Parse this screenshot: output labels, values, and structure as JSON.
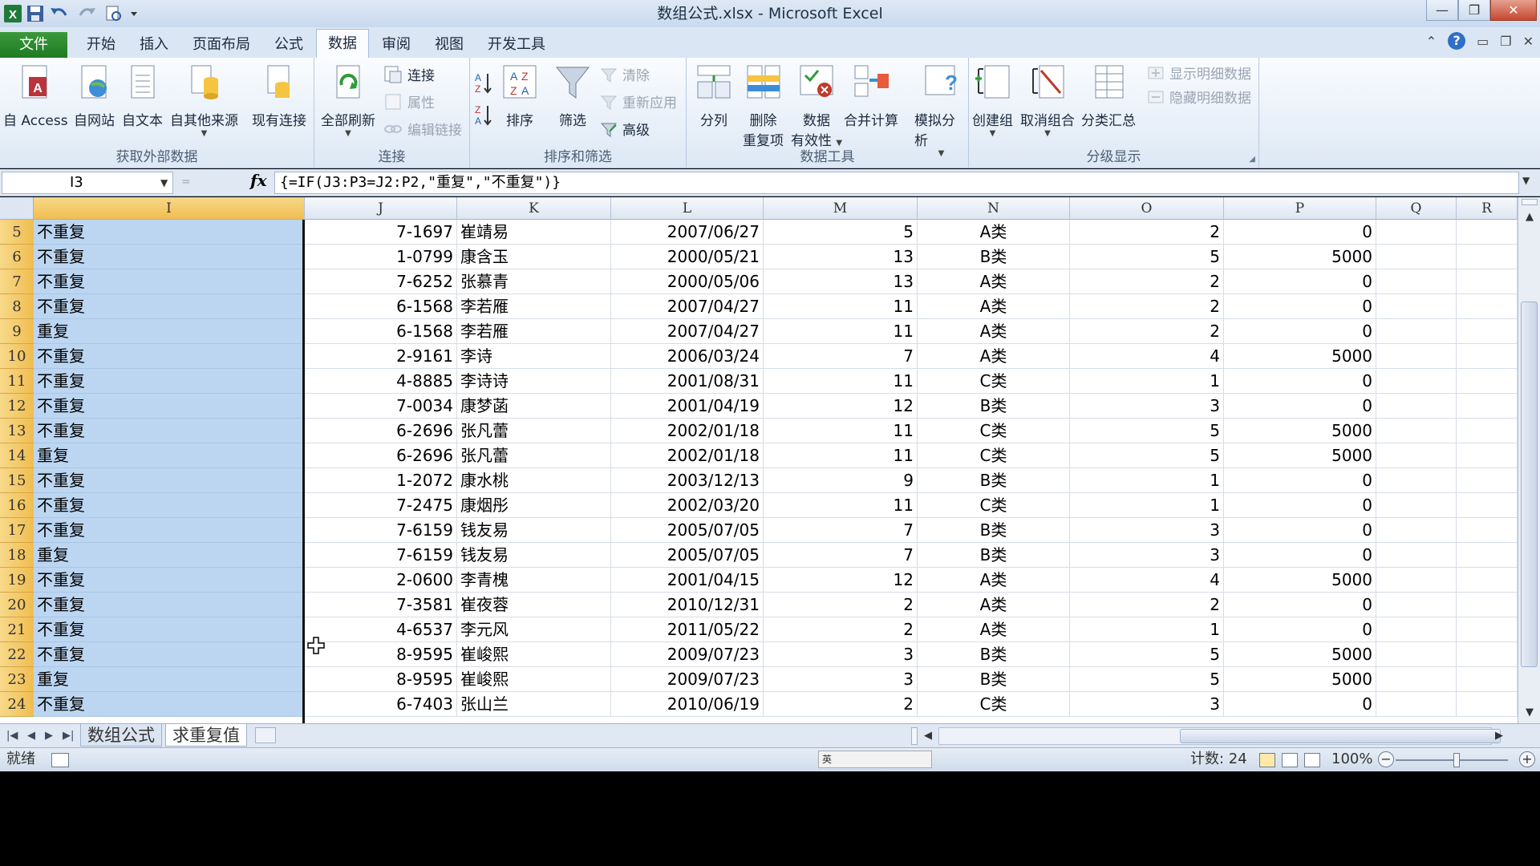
{
  "window": {
    "title": "数组公式.xlsx - Microsoft Excel"
  },
  "tabs": [
    {
      "label": "文件"
    },
    {
      "label": "开始"
    },
    {
      "label": "插入"
    },
    {
      "label": "页面布局"
    },
    {
      "label": "公式"
    },
    {
      "label": "数据"
    },
    {
      "label": "审阅"
    },
    {
      "label": "视图"
    },
    {
      "label": "开发工具"
    }
  ],
  "ribbon": {
    "ext": {
      "label": "获取外部数据",
      "access": "自 Access",
      "web": "自网站",
      "text": "自文本",
      "other": "自其他来源",
      "existing": "现有连接"
    },
    "conn": {
      "label": "连接",
      "refresh": "全部刷新",
      "connections": "连接",
      "properties": "属性",
      "edit_links": "编辑链接"
    },
    "sort": {
      "label": "排序和筛选",
      "sort": "排序",
      "filter": "筛选",
      "clear": "清除",
      "reapply": "重新应用",
      "advanced": "高级"
    },
    "tools": {
      "label": "数据工具",
      "split": "分列",
      "remove_dup_1": "删除",
      "remove_dup_2": "重复项",
      "validation_1": "数据",
      "validation_2": "有效性",
      "consolidate": "合并计算",
      "whatif": "模拟分析"
    },
    "outline": {
      "label": "分级显示",
      "group": "创建组",
      "ungroup": "取消组合",
      "subtotal": "分类汇总",
      "show_detail": "显示明细数据",
      "hide_detail": "隐藏明细数据"
    }
  },
  "formula_bar": {
    "name_box": "I3",
    "formula": "{=IF(J3:P3=J2:P2,\"重复\",\"不重复\")}"
  },
  "columns": [
    "I",
    "J",
    "K",
    "L",
    "M",
    "N",
    "O",
    "P",
    "Q",
    "R"
  ],
  "rows": [
    {
      "num": "5",
      "I": "不重复",
      "J": "7-1697",
      "K": "崔靖易",
      "L": "2007/06/27",
      "M": "5",
      "N": "A类",
      "O": "2",
      "P": "0"
    },
    {
      "num": "6",
      "I": "不重复",
      "J": "1-0799",
      "K": "康含玉",
      "L": "2000/05/21",
      "M": "13",
      "N": "B类",
      "O": "5",
      "P": "5000"
    },
    {
      "num": "7",
      "I": "不重复",
      "J": "7-6252",
      "K": "张慕青",
      "L": "2000/05/06",
      "M": "13",
      "N": "A类",
      "O": "2",
      "P": "0"
    },
    {
      "num": "8",
      "I": "不重复",
      "J": "6-1568",
      "K": "李若雁",
      "L": "2007/04/27",
      "M": "11",
      "N": "A类",
      "O": "2",
      "P": "0"
    },
    {
      "num": "9",
      "I": "重复",
      "J": "6-1568",
      "K": "李若雁",
      "L": "2007/04/27",
      "M": "11",
      "N": "A类",
      "O": "2",
      "P": "0"
    },
    {
      "num": "10",
      "I": "不重复",
      "J": "2-9161",
      "K": "李诗",
      "L": "2006/03/24",
      "M": "7",
      "N": "A类",
      "O": "4",
      "P": "5000"
    },
    {
      "num": "11",
      "I": "不重复",
      "J": "4-8885",
      "K": "李诗诗",
      "L": "2001/08/31",
      "M": "11",
      "N": "C类",
      "O": "1",
      "P": "0"
    },
    {
      "num": "12",
      "I": "不重复",
      "J": "7-0034",
      "K": "康梦菡",
      "L": "2001/04/19",
      "M": "12",
      "N": "B类",
      "O": "3",
      "P": "0"
    },
    {
      "num": "13",
      "I": "不重复",
      "J": "6-2696",
      "K": "张凡蕾",
      "L": "2002/01/18",
      "M": "11",
      "N": "C类",
      "O": "5",
      "P": "5000"
    },
    {
      "num": "14",
      "I": "重复",
      "J": "6-2696",
      "K": "张凡蕾",
      "L": "2002/01/18",
      "M": "11",
      "N": "C类",
      "O": "5",
      "P": "5000"
    },
    {
      "num": "15",
      "I": "不重复",
      "J": "1-2072",
      "K": "康水桃",
      "L": "2003/12/13",
      "M": "9",
      "N": "B类",
      "O": "1",
      "P": "0"
    },
    {
      "num": "16",
      "I": "不重复",
      "J": "7-2475",
      "K": "康烟彤",
      "L": "2002/03/20",
      "M": "11",
      "N": "C类",
      "O": "1",
      "P": "0"
    },
    {
      "num": "17",
      "I": "不重复",
      "J": "7-6159",
      "K": "钱友易",
      "L": "2005/07/05",
      "M": "7",
      "N": "B类",
      "O": "3",
      "P": "0"
    },
    {
      "num": "18",
      "I": "重复",
      "J": "7-6159",
      "K": "钱友易",
      "L": "2005/07/05",
      "M": "7",
      "N": "B类",
      "O": "3",
      "P": "0"
    },
    {
      "num": "19",
      "I": "不重复",
      "J": "2-0600",
      "K": "李青槐",
      "L": "2001/04/15",
      "M": "12",
      "N": "A类",
      "O": "4",
      "P": "5000"
    },
    {
      "num": "20",
      "I": "不重复",
      "J": "7-3581",
      "K": "崔夜蓉",
      "L": "2010/12/31",
      "M": "2",
      "N": "A类",
      "O": "2",
      "P": "0"
    },
    {
      "num": "21",
      "I": "不重复",
      "J": "4-6537",
      "K": "李元风",
      "L": "2011/05/22",
      "M": "2",
      "N": "A类",
      "O": "1",
      "P": "0"
    },
    {
      "num": "22",
      "I": "不重复",
      "J": "8-9595",
      "K": "崔峻熙",
      "L": "2009/07/23",
      "M": "3",
      "N": "B类",
      "O": "5",
      "P": "5000"
    },
    {
      "num": "23",
      "I": "重复",
      "J": "8-9595",
      "K": "崔峻熙",
      "L": "2009/07/23",
      "M": "3",
      "N": "B类",
      "O": "5",
      "P": "5000"
    },
    {
      "num": "24",
      "I": "不重复",
      "J": "6-7403",
      "K": "张山兰",
      "L": "2010/06/19",
      "M": "2",
      "N": "C类",
      "O": "3",
      "P": "0"
    }
  ],
  "sheets": [
    {
      "label": "数组公式"
    },
    {
      "label": "求重复值"
    }
  ],
  "status": {
    "ready": "就绪",
    "count": "计数: 24",
    "zoom": "100%",
    "ime": "英"
  }
}
